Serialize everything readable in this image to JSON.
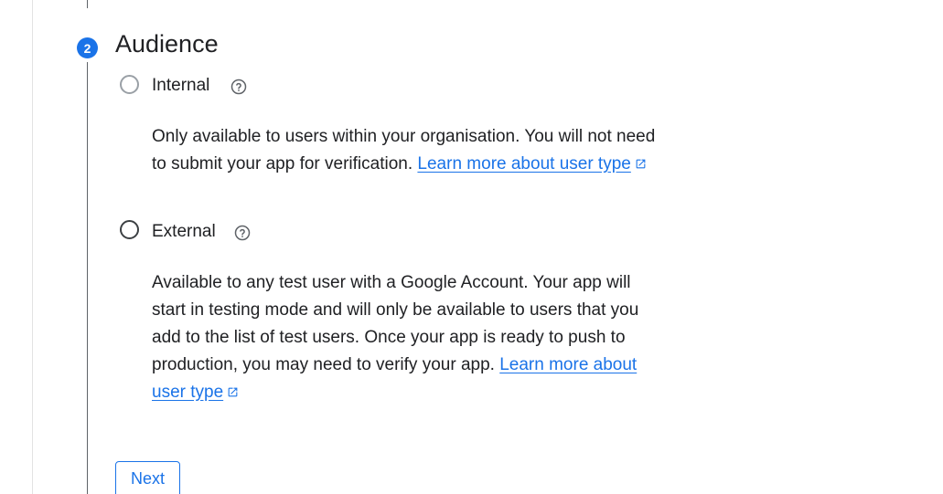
{
  "step": {
    "number": "2",
    "title": "Audience"
  },
  "options": {
    "internal": {
      "label": "Internal",
      "description_line1": "Only available to users within your organisation. You will not need to submit your app for verification.",
      "link": "Learn more about user type",
      "selected": false
    },
    "external": {
      "label": "External",
      "description_line1": "Available to any test user with a Google Account. Your app will start in testing mode and will only be available to users that you add to the list of test users. Once your app is ready to push to production, you may need to verify your app.",
      "link": "Learn more about user type",
      "selected": false
    }
  },
  "actions": {
    "next_label": "Next"
  },
  "colors": {
    "accent": "#1a73e8",
    "text": "#202124",
    "line": "#5f6368"
  },
  "icons": {
    "help": "help-circle-icon",
    "external_link": "open-in-new-icon"
  }
}
